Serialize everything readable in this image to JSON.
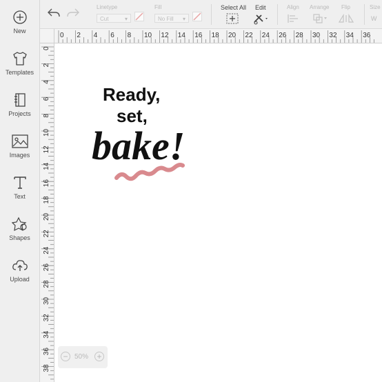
{
  "sidebar": {
    "items": [
      {
        "label": "New",
        "icon": "plus-circle-icon"
      },
      {
        "label": "Templates",
        "icon": "tshirt-icon"
      },
      {
        "label": "Projects",
        "icon": "notebook-icon"
      },
      {
        "label": "Images",
        "icon": "image-icon"
      },
      {
        "label": "Text",
        "icon": "text-t-icon"
      },
      {
        "label": "Shapes",
        "icon": "shapes-icon"
      },
      {
        "label": "Upload",
        "icon": "cloud-upload-icon"
      }
    ]
  },
  "toolbar": {
    "linetype_label": "Linetype",
    "linetype_value": "Cut",
    "fill_label": "Fill",
    "fill_value": "No Fill",
    "select_all_label": "Select All",
    "edit_label": "Edit",
    "align_label": "Align",
    "arrange_label": "Arrange",
    "flip_label": "Flip",
    "size_label": "Size",
    "size_w_label": "W"
  },
  "ruler": {
    "h_ticks": [
      "0",
      "2",
      "4",
      "6",
      "8",
      "10",
      "12",
      "14",
      "16",
      "18",
      "20",
      "22",
      "24",
      "26",
      "28",
      "30",
      "32",
      "34",
      "36"
    ],
    "v_ticks": [
      "0",
      "2",
      "4",
      "6",
      "8",
      "10",
      "12",
      "14",
      "16",
      "18",
      "20",
      "22",
      "24",
      "26",
      "28",
      "30",
      "32",
      "34",
      "36",
      "38"
    ]
  },
  "design": {
    "line1": "Ready,",
    "line2": "set,",
    "line3": "bake!",
    "squiggle_color": "#d98a8e",
    "ink_color": "#111111"
  },
  "zoom": {
    "minus": "−",
    "value": "50%",
    "plus": "+"
  },
  "colors": {
    "accent_disabled": "#e8a3a3",
    "sidebar_bg": "#efefef",
    "toolbar_bg": "#efefef"
  }
}
